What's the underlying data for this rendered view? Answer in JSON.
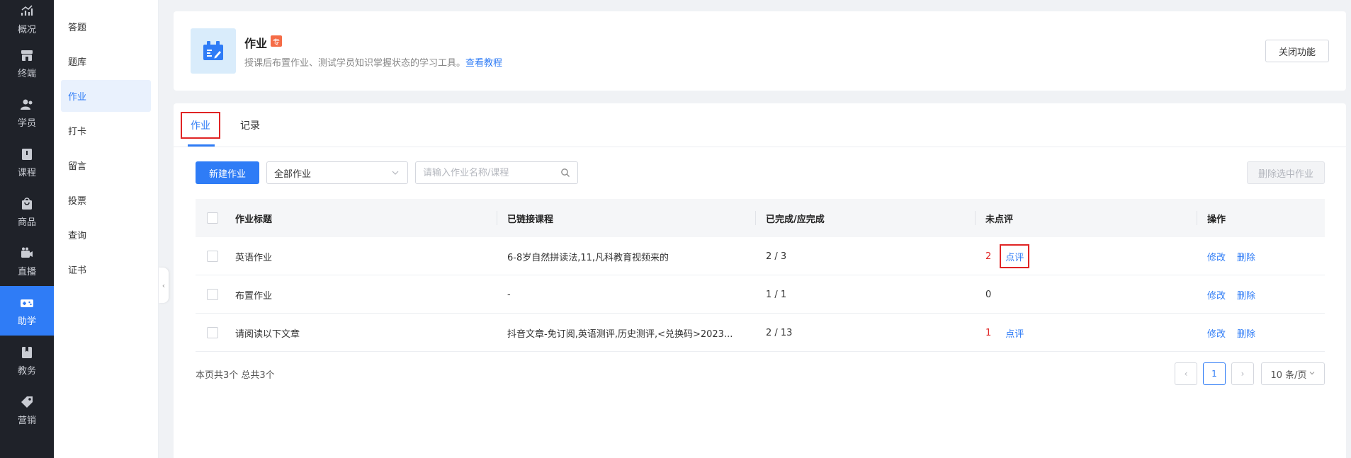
{
  "rail": {
    "items": [
      {
        "label": "概况",
        "icon": "chart-icon"
      },
      {
        "label": "终端",
        "icon": "store-icon"
      },
      {
        "label": "学员",
        "icon": "users-icon"
      },
      {
        "label": "课程",
        "icon": "book-icon"
      },
      {
        "label": "商品",
        "icon": "bag-icon"
      },
      {
        "label": "直播",
        "icon": "camera-icon"
      },
      {
        "label": "助学",
        "icon": "gamepad-icon"
      },
      {
        "label": "教务",
        "icon": "bookmark-icon"
      },
      {
        "label": "营销",
        "icon": "tag-icon"
      }
    ],
    "active_index": 6,
    "accent": "#2f7cf6"
  },
  "submenu": {
    "items": [
      "答题",
      "题库",
      "作业",
      "打卡",
      "留言",
      "投票",
      "查询",
      "证书"
    ],
    "active_index": 2
  },
  "header": {
    "title": "作业",
    "badge": "专",
    "description": "授课后布置作业、测试学员知识掌握状态的学习工具。",
    "tutorial_link": "查看教程",
    "close_button": "关闭功能"
  },
  "tabs": [
    {
      "label": "作业",
      "active": true
    },
    {
      "label": "记录",
      "active": false
    }
  ],
  "toolbar": {
    "new_button": "新建作业",
    "filter_value": "全部作业",
    "search_placeholder": "请输入作业名称/课程",
    "delete_selected": "删除选中作业"
  },
  "table": {
    "headers": {
      "title": "作业标题",
      "course": "已链接课程",
      "done": "已完成/应完成",
      "unreviewed": "未点评",
      "ops": "操作"
    },
    "rows": [
      {
        "title": "英语作业",
        "course": "6-8岁自然拼读法,11,凡科教育视频来的",
        "done": "2 / 3",
        "unreviewed": "2",
        "review": "点评",
        "edit": "修改",
        "delete": "删除"
      },
      {
        "title": "布置作业",
        "course": "-",
        "done": "1 / 1",
        "unreviewed": "0",
        "review": "",
        "edit": "修改",
        "delete": "删除"
      },
      {
        "title": "请阅读以下文章",
        "course": "抖音文章-免订阅,英语测评,历史测评,<兑换码>2023...",
        "done": "2 / 13",
        "unreviewed": "1",
        "review": "点评",
        "edit": "修改",
        "delete": "删除"
      }
    ]
  },
  "footer": {
    "count_text": "本页共3个 总共3个",
    "current_page": "1",
    "page_size": "10 条/页"
  }
}
